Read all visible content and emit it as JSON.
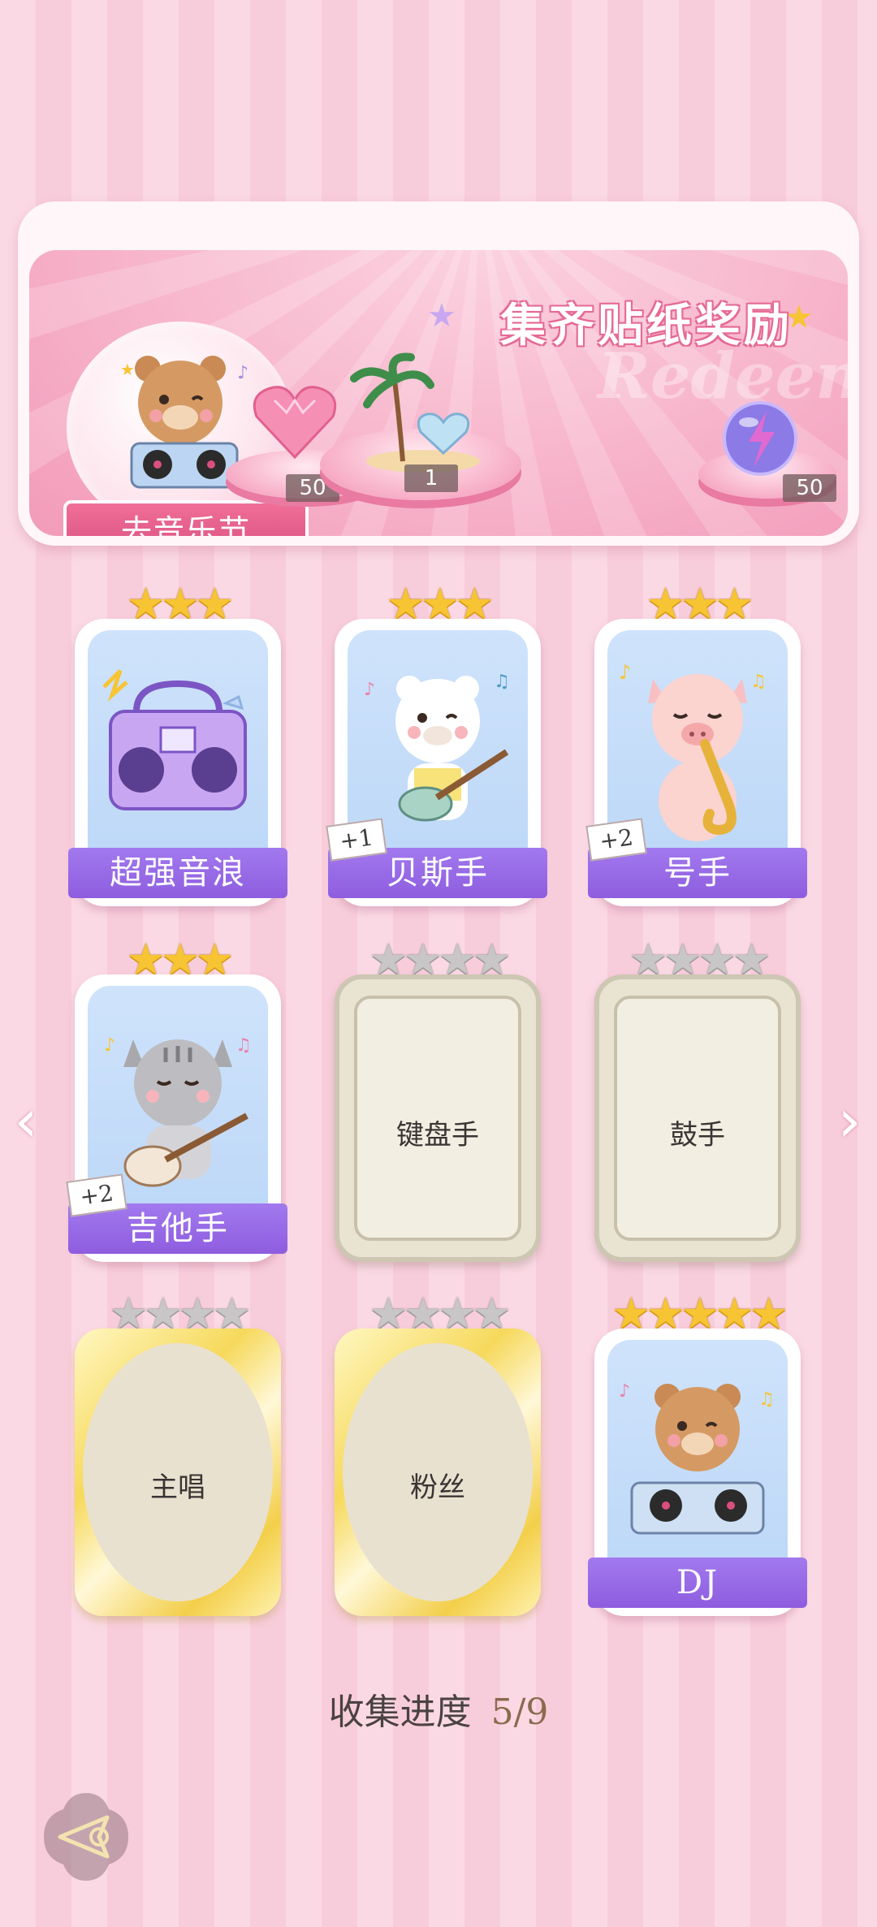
{
  "banner": {
    "title": "集齐贴纸奖励",
    "ghost_text": "Redeem",
    "festival_button": "去音乐节",
    "rewards": [
      {
        "name": "pink-heart-gem",
        "count": "50"
      },
      {
        "name": "island-heart-decoration",
        "count": "1"
      },
      {
        "name": "purple-lightning-orb",
        "count": "50"
      }
    ]
  },
  "cards": [
    {
      "label": "超强音浪",
      "stars": 3,
      "state": "collected",
      "plus": ""
    },
    {
      "label": "贝斯手",
      "stars": 3,
      "state": "collected",
      "plus": "+1"
    },
    {
      "label": "号手",
      "stars": 3,
      "state": "collected",
      "plus": "+2"
    },
    {
      "label": "吉他手",
      "stars": 3,
      "state": "collected",
      "plus": "+2"
    },
    {
      "label": "键盘手",
      "stars": 4,
      "state": "locked",
      "plus": ""
    },
    {
      "label": "鼓手",
      "stars": 4,
      "state": "locked",
      "plus": ""
    },
    {
      "label": "主唱",
      "stars": 4,
      "state": "locked-gold",
      "plus": ""
    },
    {
      "label": "粉丝",
      "stars": 4,
      "state": "locked-gold",
      "plus": ""
    },
    {
      "label": "DJ",
      "stars": 5,
      "state": "collected",
      "plus": ""
    }
  ],
  "progress": {
    "label": "收集进度",
    "value": "5/9"
  },
  "colors": {
    "accent_pink": "#e66a93",
    "label_purple": "#8e5ddf",
    "star_gold": "#f7c434",
    "star_gray": "#c8c6c6"
  },
  "icons": {
    "left": "chevron-left-icon",
    "right": "chevron-right-icon",
    "back": "back-arrow-icon"
  }
}
